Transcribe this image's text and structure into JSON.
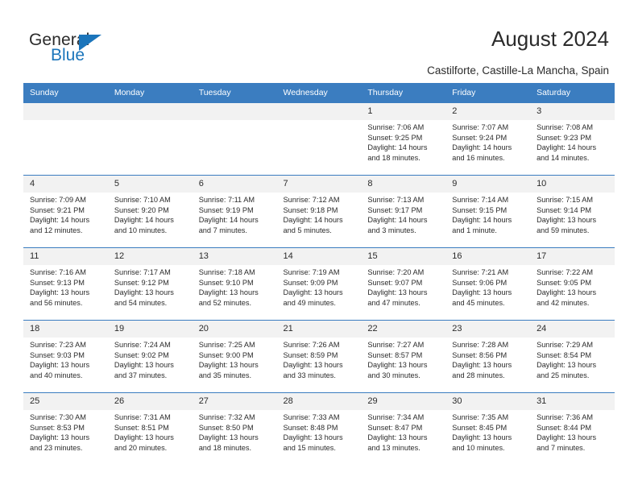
{
  "brand": {
    "name_top": "General",
    "name_bottom": "Blue",
    "accent_color": "#1b75bb"
  },
  "header": {
    "title": "August 2024",
    "subtitle": "Castilforte, Castille-La Mancha, Spain"
  },
  "calendar": {
    "header_bg": "#3b7dc0",
    "daynum_bg": "#f2f2f2",
    "weekdays": [
      "Sunday",
      "Monday",
      "Tuesday",
      "Wednesday",
      "Thursday",
      "Friday",
      "Saturday"
    ],
    "weeks": [
      [
        {
          "day": "",
          "lines": []
        },
        {
          "day": "",
          "lines": []
        },
        {
          "day": "",
          "lines": []
        },
        {
          "day": "",
          "lines": []
        },
        {
          "day": "1",
          "lines": [
            "Sunrise: 7:06 AM",
            "Sunset: 9:25 PM",
            "Daylight: 14 hours",
            "and 18 minutes."
          ]
        },
        {
          "day": "2",
          "lines": [
            "Sunrise: 7:07 AM",
            "Sunset: 9:24 PM",
            "Daylight: 14 hours",
            "and 16 minutes."
          ]
        },
        {
          "day": "3",
          "lines": [
            "Sunrise: 7:08 AM",
            "Sunset: 9:23 PM",
            "Daylight: 14 hours",
            "and 14 minutes."
          ]
        }
      ],
      [
        {
          "day": "4",
          "lines": [
            "Sunrise: 7:09 AM",
            "Sunset: 9:21 PM",
            "Daylight: 14 hours",
            "and 12 minutes."
          ]
        },
        {
          "day": "5",
          "lines": [
            "Sunrise: 7:10 AM",
            "Sunset: 9:20 PM",
            "Daylight: 14 hours",
            "and 10 minutes."
          ]
        },
        {
          "day": "6",
          "lines": [
            "Sunrise: 7:11 AM",
            "Sunset: 9:19 PM",
            "Daylight: 14 hours",
            "and 7 minutes."
          ]
        },
        {
          "day": "7",
          "lines": [
            "Sunrise: 7:12 AM",
            "Sunset: 9:18 PM",
            "Daylight: 14 hours",
            "and 5 minutes."
          ]
        },
        {
          "day": "8",
          "lines": [
            "Sunrise: 7:13 AM",
            "Sunset: 9:17 PM",
            "Daylight: 14 hours",
            "and 3 minutes."
          ]
        },
        {
          "day": "9",
          "lines": [
            "Sunrise: 7:14 AM",
            "Sunset: 9:15 PM",
            "Daylight: 14 hours",
            "and 1 minute."
          ]
        },
        {
          "day": "10",
          "lines": [
            "Sunrise: 7:15 AM",
            "Sunset: 9:14 PM",
            "Daylight: 13 hours",
            "and 59 minutes."
          ]
        }
      ],
      [
        {
          "day": "11",
          "lines": [
            "Sunrise: 7:16 AM",
            "Sunset: 9:13 PM",
            "Daylight: 13 hours",
            "and 56 minutes."
          ]
        },
        {
          "day": "12",
          "lines": [
            "Sunrise: 7:17 AM",
            "Sunset: 9:12 PM",
            "Daylight: 13 hours",
            "and 54 minutes."
          ]
        },
        {
          "day": "13",
          "lines": [
            "Sunrise: 7:18 AM",
            "Sunset: 9:10 PM",
            "Daylight: 13 hours",
            "and 52 minutes."
          ]
        },
        {
          "day": "14",
          "lines": [
            "Sunrise: 7:19 AM",
            "Sunset: 9:09 PM",
            "Daylight: 13 hours",
            "and 49 minutes."
          ]
        },
        {
          "day": "15",
          "lines": [
            "Sunrise: 7:20 AM",
            "Sunset: 9:07 PM",
            "Daylight: 13 hours",
            "and 47 minutes."
          ]
        },
        {
          "day": "16",
          "lines": [
            "Sunrise: 7:21 AM",
            "Sunset: 9:06 PM",
            "Daylight: 13 hours",
            "and 45 minutes."
          ]
        },
        {
          "day": "17",
          "lines": [
            "Sunrise: 7:22 AM",
            "Sunset: 9:05 PM",
            "Daylight: 13 hours",
            "and 42 minutes."
          ]
        }
      ],
      [
        {
          "day": "18",
          "lines": [
            "Sunrise: 7:23 AM",
            "Sunset: 9:03 PM",
            "Daylight: 13 hours",
            "and 40 minutes."
          ]
        },
        {
          "day": "19",
          "lines": [
            "Sunrise: 7:24 AM",
            "Sunset: 9:02 PM",
            "Daylight: 13 hours",
            "and 37 minutes."
          ]
        },
        {
          "day": "20",
          "lines": [
            "Sunrise: 7:25 AM",
            "Sunset: 9:00 PM",
            "Daylight: 13 hours",
            "and 35 minutes."
          ]
        },
        {
          "day": "21",
          "lines": [
            "Sunrise: 7:26 AM",
            "Sunset: 8:59 PM",
            "Daylight: 13 hours",
            "and 33 minutes."
          ]
        },
        {
          "day": "22",
          "lines": [
            "Sunrise: 7:27 AM",
            "Sunset: 8:57 PM",
            "Daylight: 13 hours",
            "and 30 minutes."
          ]
        },
        {
          "day": "23",
          "lines": [
            "Sunrise: 7:28 AM",
            "Sunset: 8:56 PM",
            "Daylight: 13 hours",
            "and 28 minutes."
          ]
        },
        {
          "day": "24",
          "lines": [
            "Sunrise: 7:29 AM",
            "Sunset: 8:54 PM",
            "Daylight: 13 hours",
            "and 25 minutes."
          ]
        }
      ],
      [
        {
          "day": "25",
          "lines": [
            "Sunrise: 7:30 AM",
            "Sunset: 8:53 PM",
            "Daylight: 13 hours",
            "and 23 minutes."
          ]
        },
        {
          "day": "26",
          "lines": [
            "Sunrise: 7:31 AM",
            "Sunset: 8:51 PM",
            "Daylight: 13 hours",
            "and 20 minutes."
          ]
        },
        {
          "day": "27",
          "lines": [
            "Sunrise: 7:32 AM",
            "Sunset: 8:50 PM",
            "Daylight: 13 hours",
            "and 18 minutes."
          ]
        },
        {
          "day": "28",
          "lines": [
            "Sunrise: 7:33 AM",
            "Sunset: 8:48 PM",
            "Daylight: 13 hours",
            "and 15 minutes."
          ]
        },
        {
          "day": "29",
          "lines": [
            "Sunrise: 7:34 AM",
            "Sunset: 8:47 PM",
            "Daylight: 13 hours",
            "and 13 minutes."
          ]
        },
        {
          "day": "30",
          "lines": [
            "Sunrise: 7:35 AM",
            "Sunset: 8:45 PM",
            "Daylight: 13 hours",
            "and 10 minutes."
          ]
        },
        {
          "day": "31",
          "lines": [
            "Sunrise: 7:36 AM",
            "Sunset: 8:44 PM",
            "Daylight: 13 hours",
            "and 7 minutes."
          ]
        }
      ]
    ]
  }
}
